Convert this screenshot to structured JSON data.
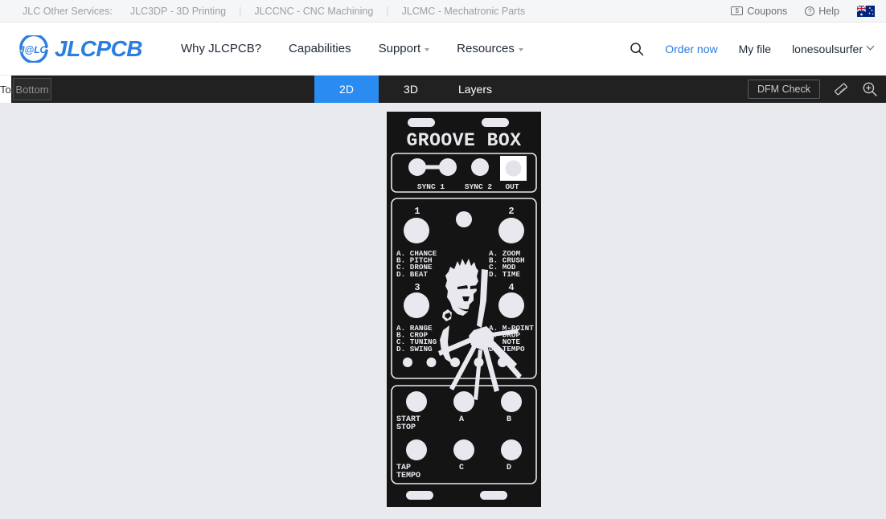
{
  "utility_bar": {
    "lead_label": "JLC Other Services:",
    "links": [
      "JLC3DP - 3D Printing",
      "JLCCNC - CNC Machining",
      "JLCMC - Mechatronic Parts"
    ],
    "coupons_label": "Coupons",
    "help_label": "Help",
    "coupons_icon": "coupon-icon",
    "help_icon": "help-circle-icon",
    "flag_icon": "australia-flag-icon"
  },
  "main_nav": {
    "logo_text": "JLCPCB",
    "logo_mark": "jlc-logo-icon",
    "items": [
      {
        "label": "Why JLCPCB?",
        "has_caret": false
      },
      {
        "label": "Capabilities",
        "has_caret": false
      },
      {
        "label": "Support",
        "has_caret": true
      },
      {
        "label": "Resources",
        "has_caret": true
      }
    ],
    "search_icon": "search-icon",
    "order_now_label": "Order now",
    "my_file_label": "My file",
    "username": "lonesoulsurfer"
  },
  "viewer_toolbar": {
    "side_tabs": [
      {
        "label": "Top",
        "active": true
      },
      {
        "label": "Bottom",
        "active": false
      }
    ],
    "view_tabs": [
      {
        "label": "2D",
        "active": true
      },
      {
        "label": "3D",
        "active": false
      },
      {
        "label": "Layers",
        "active": false
      }
    ],
    "dfm_check_label": "DFM Check",
    "measure_icon": "ruler-icon",
    "zoom_icon": "zoom-in-icon",
    "accent_color": "#2a8cf0",
    "background_color": "#212121"
  },
  "pcb": {
    "title": "GROOVE BOX",
    "silkscreen_color": "#e8e8ee",
    "board_color": "#141414",
    "canvas_background": "#e8eaed",
    "sections": {
      "io": {
        "labels": [
          "SYNC 1",
          "SYNC 2",
          "OUT"
        ]
      },
      "knobs": {
        "numbers": [
          "1",
          "2",
          "3",
          "4"
        ],
        "group_top_left": [
          "A. CHANCE",
          "B. PITCH",
          "C. DRONE",
          "D. BEAT"
        ],
        "group_top_right": [
          "A. ZOOM",
          "B. CRUSH",
          "C. MOD",
          "D. TIME"
        ],
        "group_bottom_left": [
          "A. RANGE",
          "B. CROP",
          "C. TUNING",
          "D. SWING"
        ],
        "group_bottom_right": [
          "A. M-POINT",
          "B. DROP",
          "C. NOTE",
          "D. TEMPO"
        ],
        "led_count": 5
      },
      "buttons": {
        "row1": [
          "START\nSTOP",
          "A",
          "B"
        ],
        "row1_labels": [
          [
            "START",
            "STOP"
          ],
          [
            "A"
          ],
          [
            "B"
          ]
        ],
        "row2_labels": [
          [
            "TAP",
            "TEMPO"
          ],
          [
            "C"
          ],
          [
            "D"
          ]
        ]
      }
    }
  }
}
